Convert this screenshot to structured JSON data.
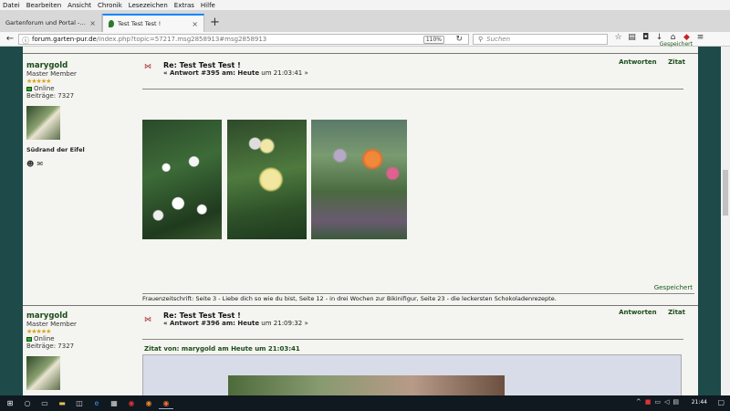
{
  "menubar": {
    "items": [
      "Datei",
      "Bearbeiten",
      "Ansicht",
      "Chronik",
      "Lesezeichen",
      "Extras",
      "Hilfe"
    ]
  },
  "tabs": [
    {
      "label": "Gartenforum und Portal - von ...",
      "active": false
    },
    {
      "label": "Test Test Test !",
      "active": true
    }
  ],
  "navbar": {
    "url_domain": "forum.garten-pur.de",
    "url_prefix": "",
    "url_rest": "/index.php?topic=57217.msg2858913#msg2858913",
    "zoom": "110%",
    "search_placeholder": "Suchen"
  },
  "posts": [
    {
      "author": "marygold",
      "rank": "Master Member",
      "stars": "★★★★★",
      "online": "Online",
      "posts_count": "Beiträge: 7327",
      "location": "Südrand der Eifel",
      "title": "Re: Test Test Test !",
      "meta_prefix": "« Antwort #395 am: ",
      "meta_day": "Heute",
      "meta_time": " um 21:03:41 »",
      "reply": "Antworten",
      "quote": "Zitat",
      "saved": "Gespeichert",
      "signature": "Frauenzeitschrift: Seite 3 - Liebe dich so wie du bist, Seite 12 - in drei Wochen zur Bikinifigur, Seite 23 - die leckersten Schokoladenrezepte."
    },
    {
      "author": "marygold",
      "rank": "Master Member",
      "stars": "★★★★★",
      "online": "Online",
      "posts_count": "Beiträge: 7327",
      "title": "Re: Test Test Test !",
      "meta_prefix": "« Antwort #396 am: ",
      "meta_day": "Heute",
      "meta_time": " um 21:09:32 »",
      "reply": "Antworten",
      "quote": "Zitat",
      "quote_header": "Zitat von: marygold am Heute um 21:03:41"
    }
  ],
  "top_saved": "Gespeichert",
  "taskbar": {
    "clock": "21:44"
  },
  "colors": {
    "accent": "#1a4d1a",
    "page_bg": "#1e4a4a",
    "content_bg": "#f4f4f0"
  }
}
